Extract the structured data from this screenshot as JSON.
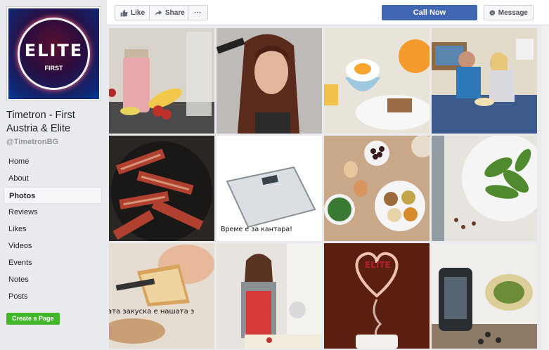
{
  "page": {
    "name": "Timetron - First Austria & Elite",
    "handle": "@TimetronBG",
    "logo_text": "ELITE",
    "logo_sub": "FIRST"
  },
  "nav": {
    "items": [
      {
        "label": "Home"
      },
      {
        "label": "About"
      },
      {
        "label": "Photos"
      },
      {
        "label": "Reviews"
      },
      {
        "label": "Likes"
      },
      {
        "label": "Videos"
      },
      {
        "label": "Events"
      },
      {
        "label": "Notes"
      },
      {
        "label": "Posts"
      }
    ],
    "active": "Photos"
  },
  "create_page_label": "Create a Page",
  "actions": {
    "like": "Like",
    "share": "Share",
    "more": "···",
    "call": "Call Now",
    "message": "Message"
  },
  "photos": {
    "captions": {
      "scale": "Време е за кантара!",
      "breakfast": "ата закуска е нашата з",
      "coffee_logo": "ELITE"
    }
  },
  "colors": {
    "brand_blue": "#4267b2",
    "create_green": "#42b72a",
    "background": "#e9ebee"
  }
}
